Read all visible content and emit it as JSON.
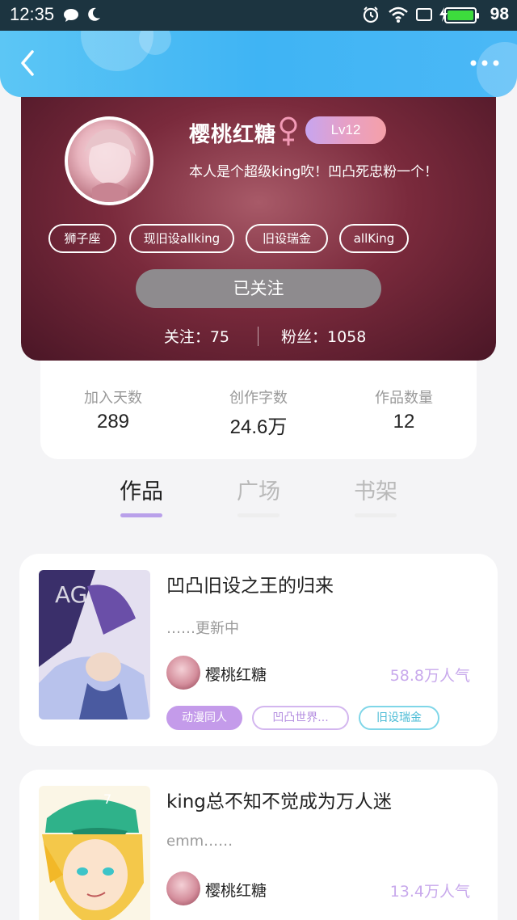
{
  "status_bar": {
    "time": "12:35",
    "battery": "98"
  },
  "profile": {
    "nickname": "樱桃红糖",
    "level": "Lv12",
    "bio": "本人是个超级king吹！凹凸死忠粉一个！",
    "tags": [
      "狮子座",
      "现旧设allking",
      "旧设瑞金",
      "allKing"
    ],
    "follow_button": "已关注",
    "following": "关注：75",
    "fans": "粉丝：1058"
  },
  "stats": [
    {
      "label": "加入天数",
      "value": "289"
    },
    {
      "label": "创作字数",
      "value": "24.6万"
    },
    {
      "label": "作品数量",
      "value": "12"
    }
  ],
  "tabs": [
    "作品",
    "广场",
    "书架"
  ],
  "works": [
    {
      "title": "凹凸旧设之王的归来",
      "desc": "……更新中",
      "author": "樱桃红糖",
      "popularity": "58.8万人气",
      "tags": [
        "动漫同人",
        "凹凸世界...",
        "旧设瑞金"
      ]
    },
    {
      "title": "king总不知不觉成为万人迷",
      "desc": "emm……",
      "author": "樱桃红糖",
      "popularity": "13.4万人气",
      "tags": []
    }
  ],
  "colors": {
    "nav_blue": "#3fb4f4",
    "accent_purple": "#b9a0ea",
    "profile_bg": "#7a2a3c"
  }
}
